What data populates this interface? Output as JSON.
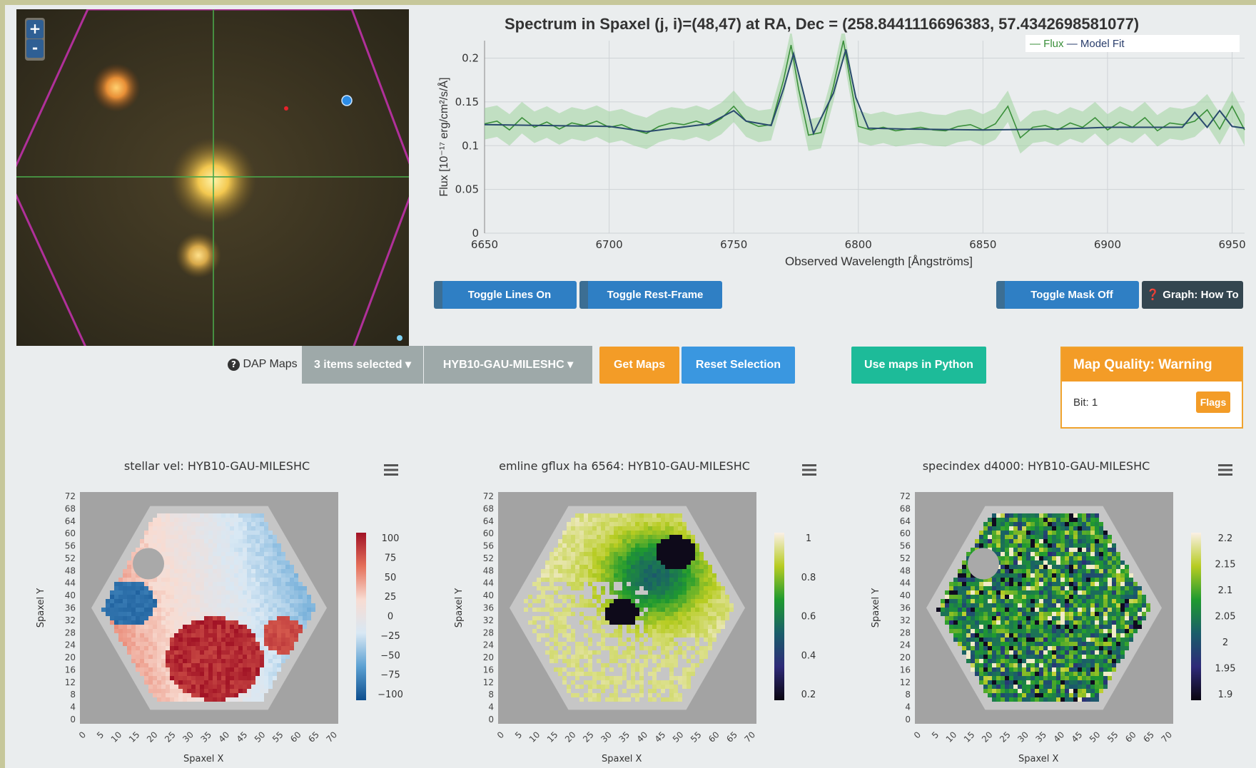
{
  "viewer": {
    "zoom_in": "+",
    "zoom_out": "-",
    "colors": {
      "hex_outline": "#b0309a",
      "crosshair": "#4aa64a",
      "marker_blue": "#2c8ce6",
      "marker_red": "#e8222b"
    }
  },
  "spectrum": {
    "title": "Spectrum in Spaxel (j, i)=(48,47) at RA, Dec = (258.8441116696383, 57.4342698581077)",
    "legend": {
      "flux": "Flux",
      "model": "Model Fit"
    },
    "ylabel": "Flux [10⁻¹⁷ erg/cm²/s/Å]",
    "xlabel": "Observed Wavelength [Ångströms]",
    "buttons": {
      "toggle_lines": "Toggle Lines On",
      "toggle_rest": "Toggle Rest-Frame",
      "toggle_mask": "Toggle Mask Off",
      "howto": "Graph: How To"
    },
    "chart_data": {
      "type": "line",
      "x_ticks": [
        "6650",
        "6700",
        "6750",
        "6800",
        "6850",
        "6900",
        "6950"
      ],
      "y_ticks": [
        "0",
        "0.05",
        "0.1",
        "0.15",
        "0.2"
      ],
      "xlim": [
        6650,
        6955
      ],
      "ylim": [
        0,
        0.22
      ],
      "series": [
        {
          "name": "Flux",
          "color": "#3a8f3a",
          "x": [
            6650,
            6655,
            6660,
            6665,
            6670,
            6675,
            6680,
            6685,
            6690,
            6695,
            6700,
            6705,
            6710,
            6715,
            6720,
            6725,
            6730,
            6735,
            6740,
            6745,
            6750,
            6755,
            6760,
            6765,
            6770,
            6773,
            6776,
            6780,
            6785,
            6790,
            6794,
            6797,
            6800,
            6805,
            6810,
            6815,
            6820,
            6825,
            6830,
            6835,
            6840,
            6845,
            6850,
            6855,
            6860,
            6865,
            6870,
            6875,
            6880,
            6885,
            6890,
            6895,
            6900,
            6905,
            6910,
            6915,
            6920,
            6925,
            6930,
            6935,
            6940,
            6945,
            6950,
            6955
          ],
          "values": [
            0.125,
            0.128,
            0.118,
            0.132,
            0.121,
            0.127,
            0.119,
            0.126,
            0.123,
            0.128,
            0.121,
            0.124,
            0.118,
            0.114,
            0.122,
            0.126,
            0.124,
            0.128,
            0.123,
            0.131,
            0.145,
            0.128,
            0.122,
            0.124,
            0.175,
            0.215,
            0.165,
            0.112,
            0.115,
            0.168,
            0.22,
            0.17,
            0.122,
            0.118,
            0.121,
            0.117,
            0.119,
            0.121,
            0.118,
            0.117,
            0.122,
            0.124,
            0.118,
            0.125,
            0.145,
            0.109,
            0.121,
            0.123,
            0.118,
            0.126,
            0.121,
            0.132,
            0.118,
            0.127,
            0.121,
            0.132,
            0.117,
            0.126,
            0.124,
            0.128,
            0.141,
            0.119,
            0.145,
            0.118
          ]
        },
        {
          "name": "Model Fit",
          "color": "#2a4a6e",
          "x": [
            6650,
            6700,
            6715,
            6740,
            6750,
            6755,
            6765,
            6770,
            6774,
            6778,
            6782,
            6790,
            6795,
            6799,
            6804,
            6820,
            6850,
            6880,
            6900,
            6930,
            6935,
            6940,
            6945,
            6950,
            6955
          ],
          "values": [
            0.124,
            0.122,
            0.116,
            0.125,
            0.14,
            0.128,
            0.123,
            0.165,
            0.205,
            0.16,
            0.114,
            0.16,
            0.21,
            0.155,
            0.12,
            0.119,
            0.118,
            0.119,
            0.121,
            0.121,
            0.138,
            0.121,
            0.14,
            0.122,
            0.12
          ]
        }
      ]
    }
  },
  "controls": {
    "dap_label": "DAP Maps",
    "items_selected": "3 items selected",
    "bintype": "HYB10-GAU-MILESHC",
    "get_maps": "Get Maps",
    "reset": "Reset Selection",
    "python": "Use maps in Python",
    "quality_title": "Map Quality: Warning",
    "bit_label": "Bit: 1",
    "flags": "Flags"
  },
  "maps": [
    {
      "title": "stellar vel: HYB10-GAU-MILESHC",
      "ylabel": "Spaxel Y",
      "xlabel": "Spaxel X",
      "x_ticks": [
        "0",
        "5",
        "10",
        "15",
        "20",
        "25",
        "30",
        "35",
        "40",
        "45",
        "50",
        "55",
        "60",
        "65",
        "70"
      ],
      "y_ticks": [
        "72",
        "68",
        "64",
        "60",
        "56",
        "52",
        "48",
        "44",
        "40",
        "36",
        "32",
        "28",
        "24",
        "20",
        "16",
        "12",
        "8",
        "4",
        "0"
      ],
      "colorbar_ticks": [
        "100",
        "75",
        "50",
        "25",
        "0",
        "−25",
        "−50",
        "−75",
        "−100"
      ],
      "colorbar_colors": [
        "#a11225",
        "#e5705a",
        "#f8dcd2",
        "#d8e8f4",
        "#5ba0d2",
        "#0d4e8e"
      ]
    },
    {
      "title": "emline gflux ha 6564: HYB10-GAU-MILESHC",
      "ylabel": "Spaxel Y",
      "xlabel": "Spaxel X",
      "x_ticks": [
        "0",
        "5",
        "10",
        "15",
        "20",
        "25",
        "30",
        "35",
        "40",
        "45",
        "50",
        "55",
        "60",
        "65",
        "70"
      ],
      "y_ticks": [
        "72",
        "68",
        "64",
        "60",
        "56",
        "52",
        "48",
        "44",
        "40",
        "36",
        "32",
        "28",
        "24",
        "20",
        "16",
        "12",
        "8",
        "4",
        "0"
      ],
      "colorbar_ticks": [
        "1",
        "0.8",
        "0.6",
        "0.4",
        "0.2"
      ],
      "colorbar_colors": [
        "#fbf0e6",
        "#b7cc22",
        "#1f9a2f",
        "#1a5d6a",
        "#2e2a78",
        "#0a0610"
      ]
    },
    {
      "title": "specindex d4000: HYB10-GAU-MILESHC",
      "ylabel": "Spaxel Y",
      "xlabel": "Spaxel X",
      "x_ticks": [
        "0",
        "5",
        "10",
        "15",
        "20",
        "25",
        "30",
        "35",
        "40",
        "45",
        "50",
        "55",
        "60",
        "65",
        "70"
      ],
      "y_ticks": [
        "72",
        "68",
        "64",
        "60",
        "56",
        "52",
        "48",
        "44",
        "40",
        "36",
        "32",
        "28",
        "24",
        "20",
        "16",
        "12",
        "8",
        "4",
        "0"
      ],
      "colorbar_ticks": [
        "2.2",
        "2.15",
        "2.1",
        "2.05",
        "2",
        "1.95",
        "1.9"
      ],
      "colorbar_colors": [
        "#fbf0e6",
        "#b7cc22",
        "#1f9a2f",
        "#1a5d6a",
        "#2e2a78",
        "#0a0610"
      ]
    }
  ]
}
